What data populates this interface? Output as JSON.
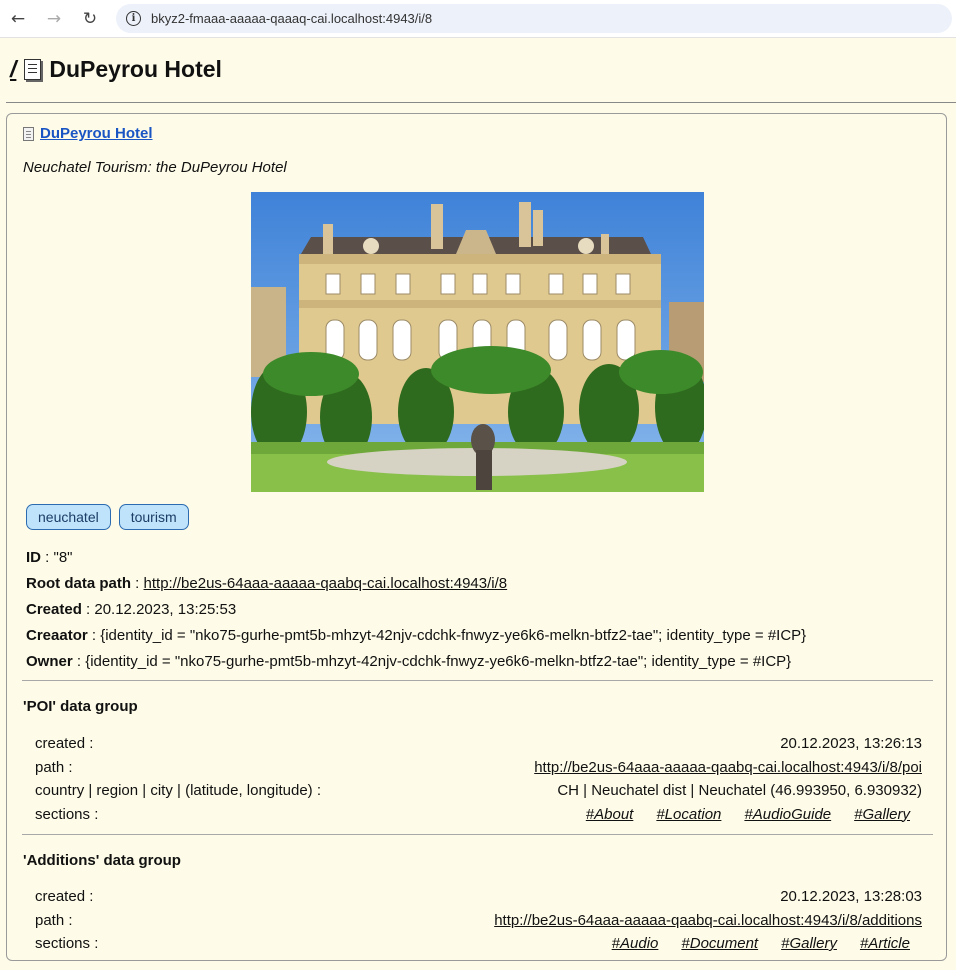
{
  "browser": {
    "back_icon": "←",
    "forward_icon": "→",
    "reload_icon": "↻",
    "info_icon": "i",
    "url": "bkyz2-fmaaa-aaaaa-qaaaq-cai.localhost:4943/i/8"
  },
  "header": {
    "root_link": "/",
    "title": "DuPeyrou Hotel"
  },
  "item": {
    "title": "DuPeyrou Hotel",
    "subtitle": "Neuchatel Tourism: the DuPeyrou Hotel",
    "tags": [
      "neuchatel",
      "tourism"
    ],
    "props": {
      "id_label": "ID",
      "id_value": " : \"8\"",
      "root_label": "Root data path",
      "root_sep": " : ",
      "root_value": "http://be2us-64aaa-aaaaa-qaabq-cai.localhost:4943/i/8",
      "created_label": "Created",
      "created_value": " : 20.12.2023, 13:25:53",
      "creator_label": "Creaator",
      "creator_value": " : {identity_id = \"nko75-gurhe-pmt5b-mhzyt-42njv-cdchk-fnwyz-ye6k6-melkn-btfz2-tae\"; identity_type = #ICP}",
      "owner_label": "Owner",
      "owner_value": " : {identity_id = \"nko75-gurhe-pmt5b-mhzyt-42njv-cdchk-fnwyz-ye6k6-melkn-btfz2-tae\"; identity_type = #ICP}"
    }
  },
  "poi_group": {
    "title": "'POI' data group",
    "created_label": "created :",
    "created_value": "20.12.2023, 13:26:13",
    "path_label": "path :",
    "path_value": "http://be2us-64aaa-aaaaa-qaabq-cai.localhost:4943/i/8/poi",
    "location_label": "country | region | city | (latitude, longitude) :",
    "location_value": "CH | Neuchatel dist | Neuchatel (46.993950, 6.930932)",
    "sections_label": "sections :",
    "sections": [
      "#About",
      "#Location",
      "#AudioGuide",
      "#Gallery"
    ]
  },
  "additions_group": {
    "title": "'Additions' data group",
    "created_label": "created :",
    "created_value": "20.12.2023, 13:28:03",
    "path_label": "path :",
    "path_value": "http://be2us-64aaa-aaaaa-qaabq-cai.localhost:4943/i/8/additions",
    "sections_label": "sections :",
    "sections": [
      "#Audio",
      "#Document",
      "#Gallery",
      "#Article"
    ]
  }
}
